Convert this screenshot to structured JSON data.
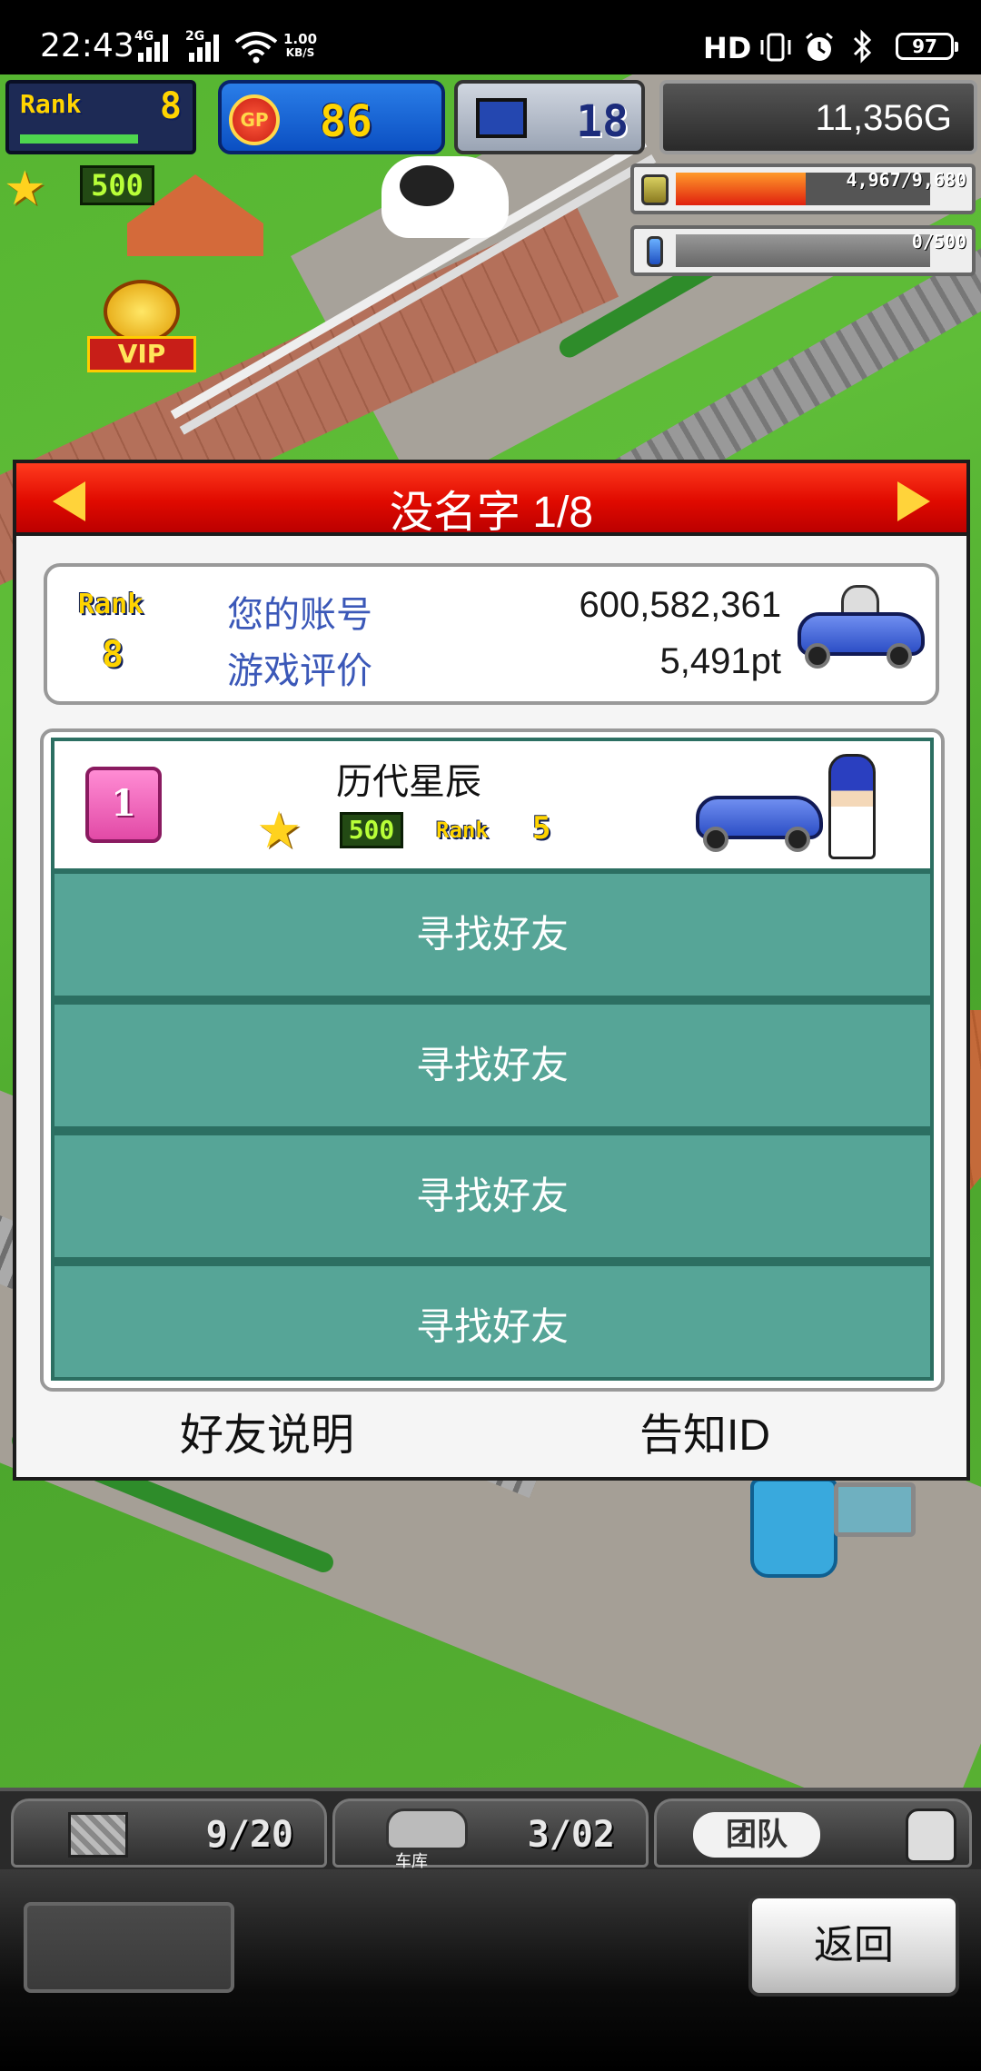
{
  "status_bar": {
    "time": "22:43",
    "signal_1": "4G",
    "signal_2": "2G",
    "net_speed_value": "1.00",
    "net_speed_unit": "KB/S",
    "hd_label": "HD",
    "battery": "97"
  },
  "hud": {
    "rank_label": "Rank",
    "rank_value": "8",
    "gp_icon_label": "GP",
    "gp_value": "86",
    "computer_value": "18",
    "money": "11,356G",
    "star_value": "500",
    "fuel_text": "4,967/9,680",
    "fuel_fraction": 0.51,
    "water_text": "0/500",
    "water_fraction": 0,
    "vip_label": "VIP"
  },
  "dialog": {
    "title": "没名字 1/8",
    "account": {
      "rank_label": "Rank",
      "rank_value": "8",
      "account_label": "您的账号",
      "account_value": "600,582,361",
      "rating_label": "游戏评价",
      "rating_value": "5,491pt"
    },
    "friend": {
      "slot_number": "1",
      "name": "历代星辰",
      "star_value": "500",
      "rank_label": "Rank",
      "rank_value": "5"
    },
    "find_buttons": [
      "寻找好友",
      "寻找好友",
      "寻找好友",
      "寻找好友"
    ],
    "help_link": "好友说明",
    "notify_id_link": "告知ID"
  },
  "bottom_tabs": {
    "items_count": "9",
    "items_max": "20",
    "garage_count": "3",
    "garage_max": "02",
    "garage_label": "车库",
    "team_label": "团队"
  },
  "bottom": {
    "back_label": "返回"
  },
  "colors": {
    "header_red": "#e00a00",
    "find_button_teal": "#56a597",
    "label_blue": "#3b58b8"
  }
}
